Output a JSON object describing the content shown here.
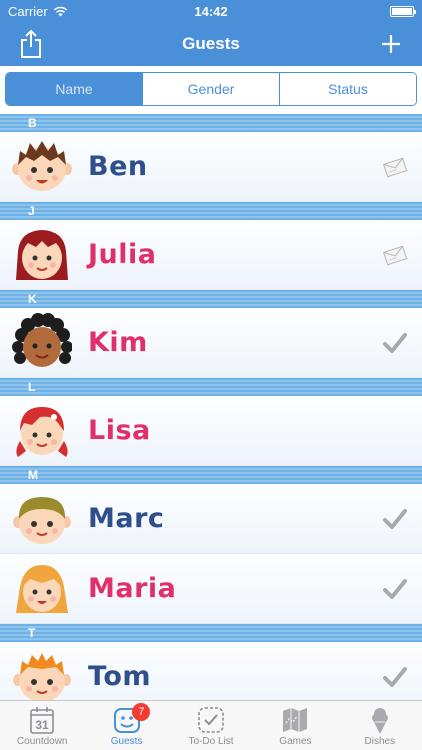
{
  "status_bar": {
    "carrier": "Carrier",
    "time": "14:42"
  },
  "nav": {
    "title": "Guests",
    "left_icon": "share-icon",
    "right_icon": "plus-icon"
  },
  "segments": [
    {
      "label": "Name",
      "selected": true
    },
    {
      "label": "Gender",
      "selected": false
    },
    {
      "label": "Status",
      "selected": false
    }
  ],
  "sections": [
    {
      "letter": "B",
      "guests": [
        {
          "name": "Ben",
          "gender": "male",
          "status": "invitation-icon"
        }
      ]
    },
    {
      "letter": "J",
      "guests": [
        {
          "name": "Julia",
          "gender": "female",
          "status": "invitation-icon"
        }
      ]
    },
    {
      "letter": "K",
      "guests": [
        {
          "name": "Kim",
          "gender": "female",
          "status": "checkmark-icon"
        }
      ]
    },
    {
      "letter": "L",
      "guests": [
        {
          "name": "Lisa",
          "gender": "female",
          "status": ""
        }
      ]
    },
    {
      "letter": "M",
      "guests": [
        {
          "name": "Marc",
          "gender": "male",
          "status": "checkmark-icon"
        },
        {
          "name": "Maria",
          "gender": "female",
          "status": "checkmark-icon"
        }
      ]
    },
    {
      "letter": "T",
      "guests": [
        {
          "name": "Tom",
          "gender": "male",
          "status": "checkmark-icon"
        }
      ]
    }
  ],
  "tabs": [
    {
      "label": "Countdown",
      "icon": "calendar-icon",
      "calendar_day": "31",
      "active": false
    },
    {
      "label": "Guests",
      "icon": "guests-icon",
      "badge": "7",
      "active": true
    },
    {
      "label": "To-Do List",
      "icon": "todo-icon",
      "active": false
    },
    {
      "label": "Games",
      "icon": "games-icon",
      "active": false
    },
    {
      "label": "Dishes",
      "icon": "dishes-icon",
      "active": false
    }
  ],
  "colors": {
    "accent": "#4a90d9",
    "male_name": "#2f4e8c",
    "female_name": "#e0306a",
    "badge": "#f33b30"
  }
}
